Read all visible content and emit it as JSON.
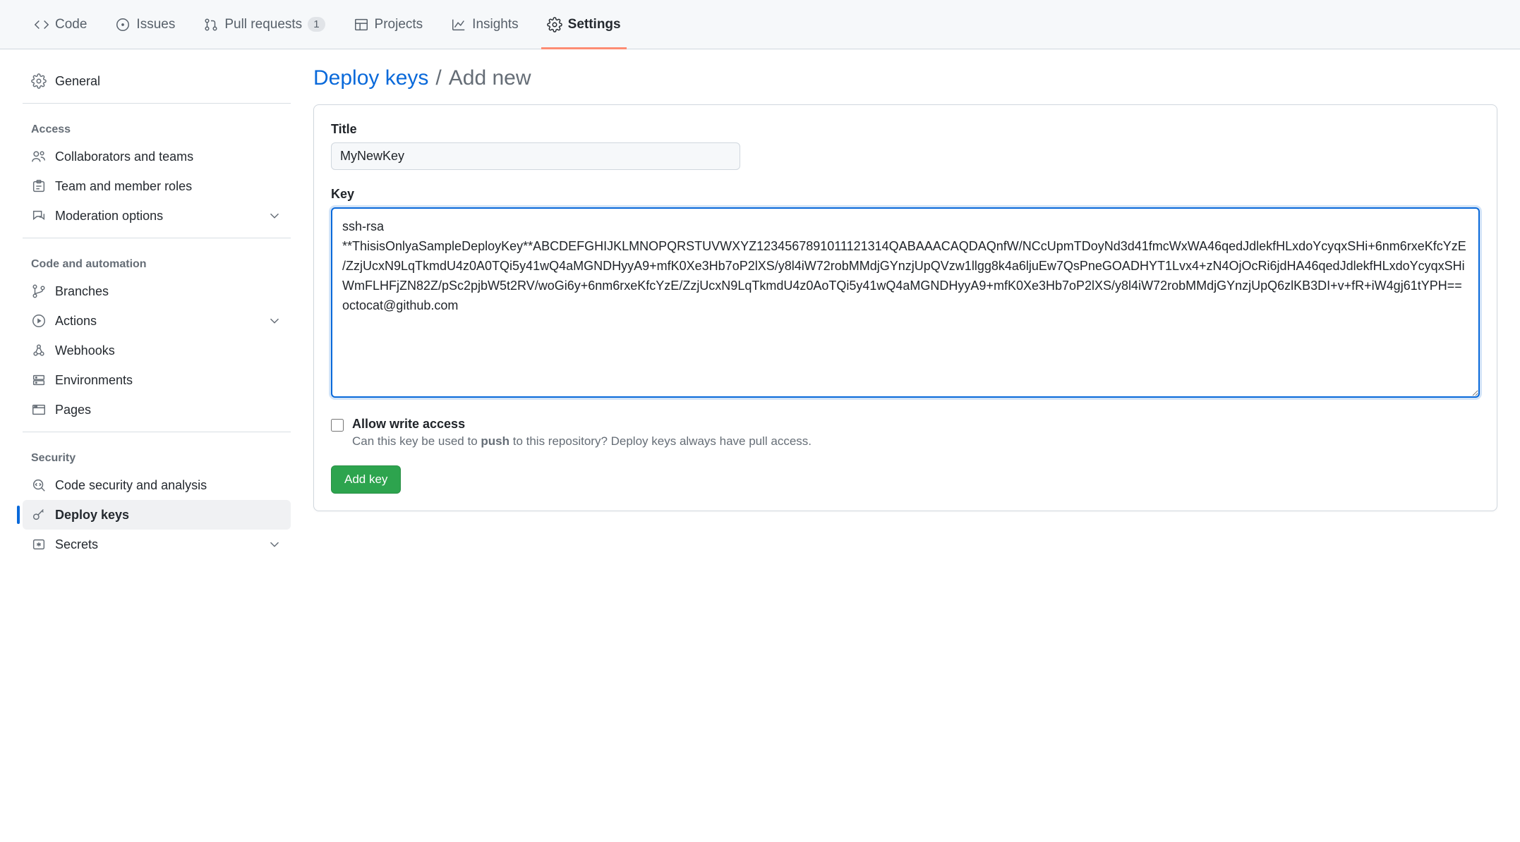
{
  "topnav": {
    "items": [
      {
        "label": "Code",
        "icon": "code"
      },
      {
        "label": "Issues",
        "icon": "issues"
      },
      {
        "label": "Pull requests",
        "icon": "pr",
        "count": "1"
      },
      {
        "label": "Projects",
        "icon": "projects"
      },
      {
        "label": "Insights",
        "icon": "insights"
      },
      {
        "label": "Settings",
        "icon": "settings",
        "active": true
      }
    ]
  },
  "sidebar": {
    "general": {
      "label": "General"
    },
    "groups": [
      {
        "heading": "Access",
        "items": [
          {
            "label": "Collaborators and teams",
            "icon": "people"
          },
          {
            "label": "Team and member roles",
            "icon": "idcard"
          },
          {
            "label": "Moderation options",
            "icon": "megaphone",
            "expandable": true
          }
        ]
      },
      {
        "heading": "Code and automation",
        "items": [
          {
            "label": "Branches",
            "icon": "branch"
          },
          {
            "label": "Actions",
            "icon": "play",
            "expandable": true
          },
          {
            "label": "Webhooks",
            "icon": "webhook"
          },
          {
            "label": "Environments",
            "icon": "server"
          },
          {
            "label": "Pages",
            "icon": "browser"
          }
        ]
      },
      {
        "heading": "Security",
        "items": [
          {
            "label": "Code security and analysis",
            "icon": "codescan"
          },
          {
            "label": "Deploy keys",
            "icon": "key",
            "selected": true
          },
          {
            "label": "Secrets",
            "icon": "asterisk",
            "expandable": true
          }
        ]
      }
    ]
  },
  "breadcrumb": {
    "link": "Deploy keys",
    "sep": "/",
    "current": "Add new"
  },
  "form": {
    "title_label": "Title",
    "title_value": "MyNewKey",
    "key_label": "Key",
    "key_value": "ssh-rsa **ThisisOnlyaSampleDeployKey**ABCDEFGHIJKLMNOPQRSTUVWXYZ1234567891011121314QABAAACAQDAQnfW/NCcUpmTDoyNd3d41fmcWxWA46qedJdlekfHLxdoYcyqxSHi+6nm6rxeKfcYzE/ZzjUcxN9LqTkmdU4z0A0TQi5y41wQ4aMGNDHyyA9+mfK0Xe3Hb7oP2lXS/y8l4iW72robMMdjGYnzjUpQVzw1llgg8k4a6ljuEw7QsPneGOADHYT1Lvx4+zN4OjOcRi6jdHA46qedJdlekfHLxdoYcyqxSHiWmFLHFjZN82Z/pSc2pjbW5t2RV/woGi6y+6nm6rxeKfcYzE/ZzjUcxN9LqTkmdU4z0AoTQi5y41wQ4aMGNDHyyA9+mfK0Xe3Hb7oP2lXS/y8l4iW72robMMdjGYnzjUpQ6zlKB3DI+v+fR+iW4gj61tYPH==octocat@github.com",
    "allow_write_label": "Allow write access",
    "allow_write_desc_pre": "Can this key be used to ",
    "allow_write_desc_bold": "push",
    "allow_write_desc_post": " to this repository? Deploy keys always have pull access.",
    "submit_label": "Add key"
  }
}
